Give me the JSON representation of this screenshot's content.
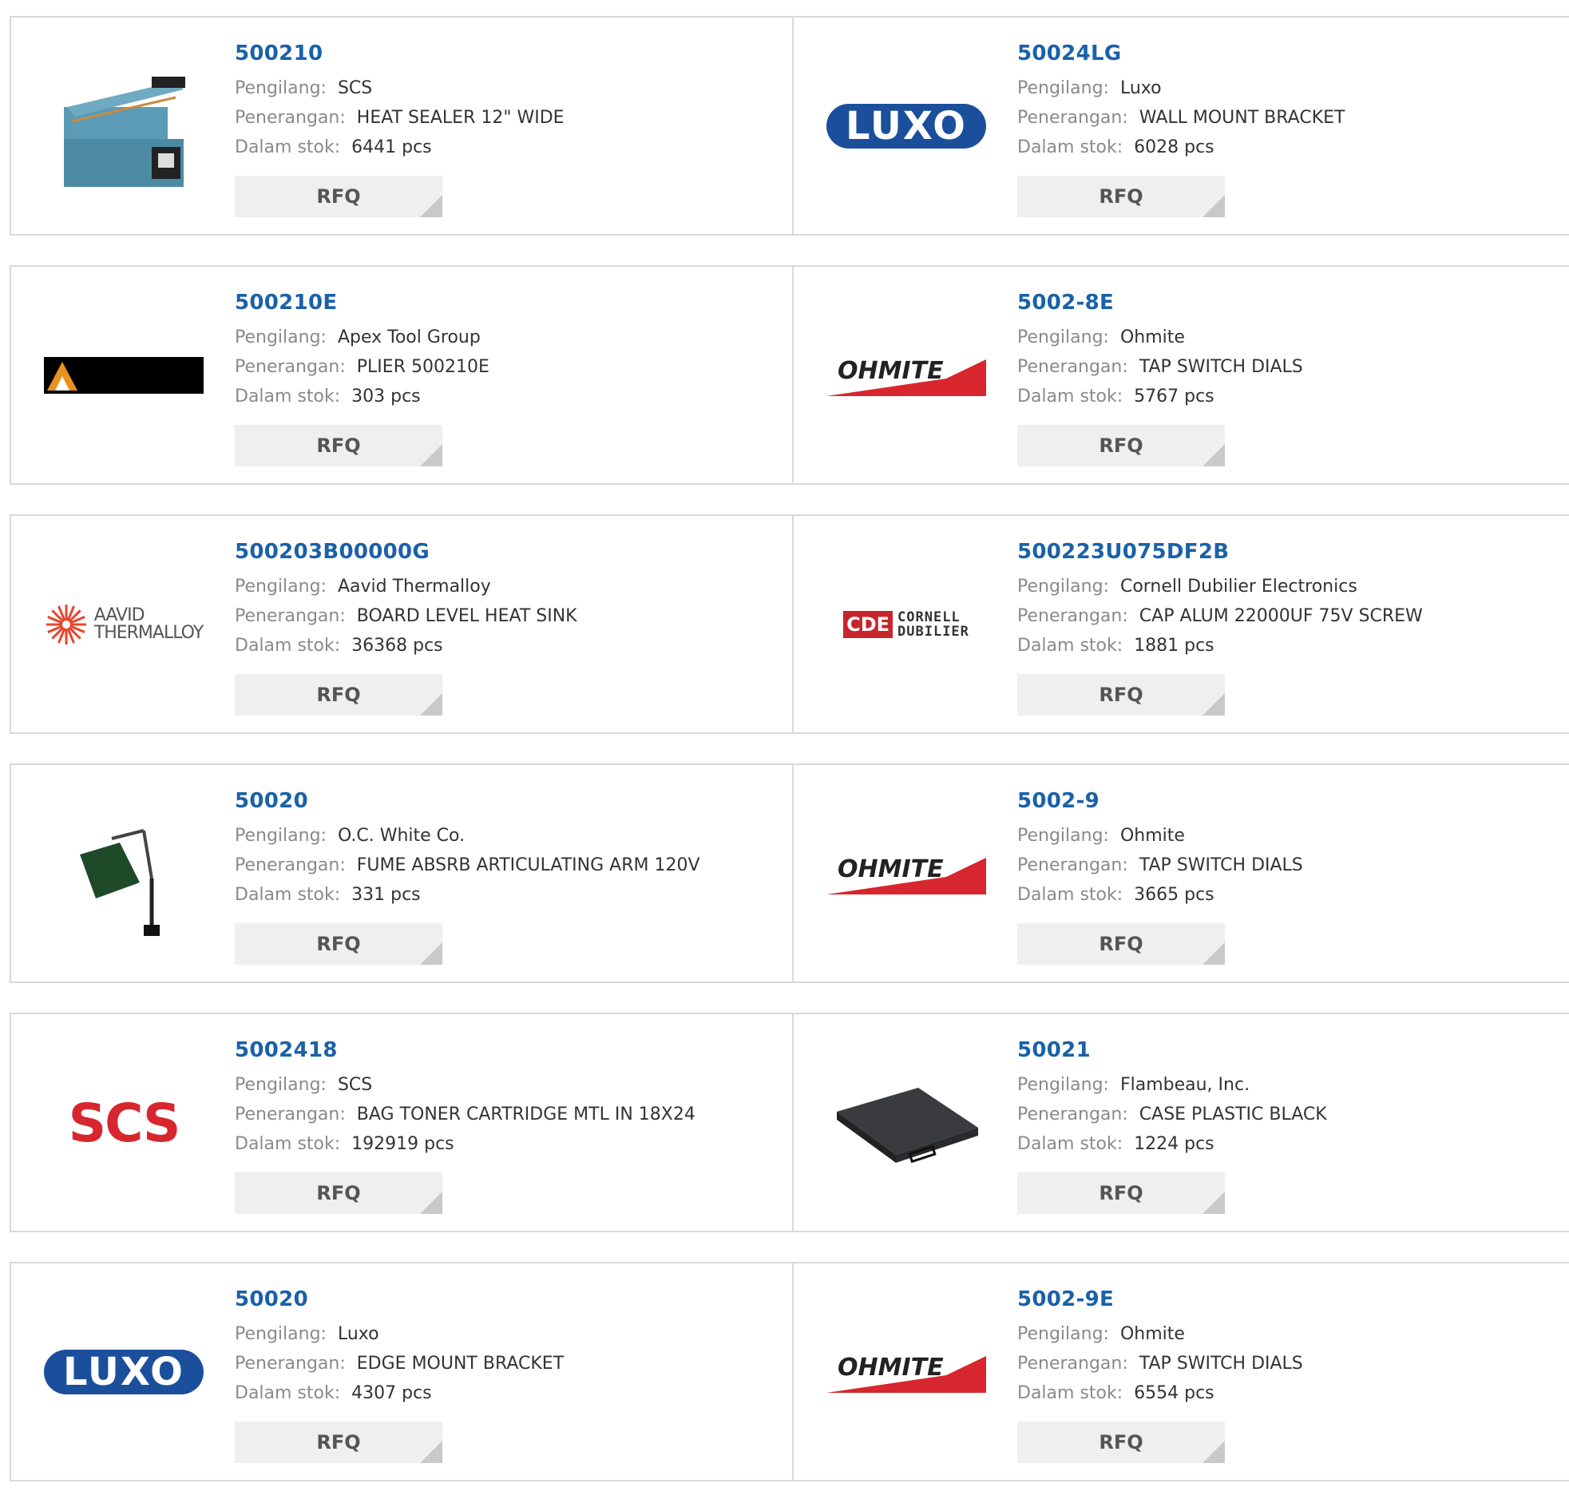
{
  "labels": {
    "manufacturer": "Pengilang:",
    "description": "Penerangan:",
    "stock": "Dalam stok:",
    "rfq": "RFQ"
  },
  "products": [
    {
      "part": "500210",
      "manufacturer": "SCS",
      "description": "HEAT SEALER 12\" WIDE",
      "stock": "6441 pcs",
      "image": "heat-sealer-image"
    },
    {
      "part": "50024LG",
      "manufacturer": "Luxo",
      "description": "WALL MOUNT BRACKET",
      "stock": "6028 pcs",
      "image": "luxo-logo",
      "logo_text": "LUXO"
    },
    {
      "part": "500210E",
      "manufacturer": "Apex Tool Group",
      "description": "PLIER 500210E",
      "stock": "303 pcs",
      "image": "apex-logo"
    },
    {
      "part": "5002-8E",
      "manufacturer": "Ohmite",
      "description": "TAP SWITCH DIALS",
      "stock": "5767 pcs",
      "image": "ohmite-logo",
      "logo_text": "OHMITE"
    },
    {
      "part": "500203B00000G",
      "manufacturer": "Aavid Thermalloy",
      "description": "BOARD LEVEL HEAT SINK",
      "stock": "36368 pcs",
      "image": "aavid-logo",
      "logo_text": [
        "AAVID",
        "THERMALLOY"
      ]
    },
    {
      "part": "500223U075DF2B",
      "manufacturer": "Cornell Dubilier Electronics",
      "description": "CAP ALUM 22000UF 75V SCREW",
      "stock": "1881 pcs",
      "image": "cde-logo",
      "logo_text": [
        "CDE",
        "CORNELL",
        "DUBILIER"
      ]
    },
    {
      "part": "50020",
      "manufacturer": "O.C. White Co.",
      "description": "FUME ABSRB ARTICULATING ARM 120V",
      "stock": "331 pcs",
      "image": "articulating-arm-image"
    },
    {
      "part": "5002-9",
      "manufacturer": "Ohmite",
      "description": "TAP SWITCH DIALS",
      "stock": "3665 pcs",
      "image": "ohmite-logo",
      "logo_text": "OHMITE"
    },
    {
      "part": "5002418",
      "manufacturer": "SCS",
      "description": "BAG TONER CARTRIDGE MTL IN 18X24",
      "stock": "192919 pcs",
      "image": "scs-logo",
      "logo_text": "SCS"
    },
    {
      "part": "50021",
      "manufacturer": "Flambeau, Inc.",
      "description": "CASE PLASTIC BLACK",
      "stock": "1224 pcs",
      "image": "black-case-image"
    },
    {
      "part": "50020",
      "manufacturer": "Luxo",
      "description": "EDGE MOUNT BRACKET",
      "stock": "4307 pcs",
      "image": "luxo-logo",
      "logo_text": "LUXO"
    },
    {
      "part": "5002-9E",
      "manufacturer": "Ohmite",
      "description": "TAP SWITCH DIALS",
      "stock": "6554 pcs",
      "image": "ohmite-logo",
      "logo_text": "OHMITE"
    }
  ],
  "colors": {
    "part_link": "#1a61a8",
    "luxo_blue": "#1b4f9c",
    "ohmite_red": "#d8262e",
    "scs_red": "#d8262e",
    "cde_red": "#c7252b",
    "rfq_bg": "#efefef"
  }
}
